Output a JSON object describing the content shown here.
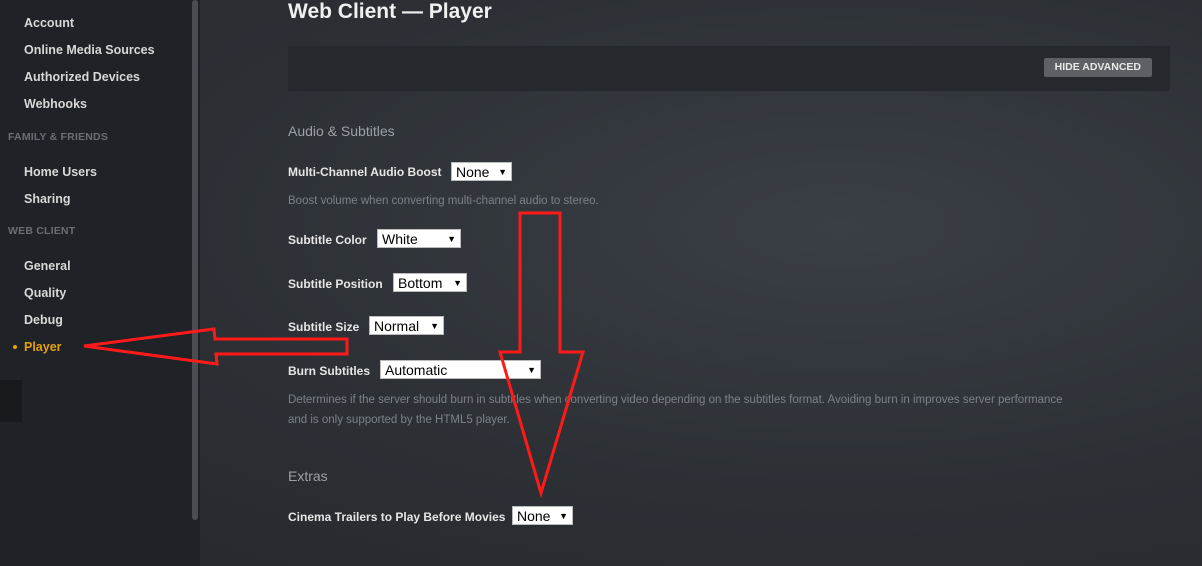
{
  "sidebar": {
    "items_top": [
      {
        "label": "Account"
      },
      {
        "label": "Online Media Sources"
      },
      {
        "label": "Authorized Devices"
      },
      {
        "label": "Webhooks"
      }
    ],
    "section_family": "FAMILY & FRIENDS",
    "items_family": [
      {
        "label": "Home Users"
      },
      {
        "label": "Sharing"
      }
    ],
    "section_web": "WEB CLIENT",
    "items_web": [
      {
        "label": "General"
      },
      {
        "label": "Quality"
      },
      {
        "label": "Debug"
      },
      {
        "label": "Player",
        "active": true
      }
    ],
    "accent_color": "#e5a00d"
  },
  "main": {
    "title": "Web Client — Player",
    "hide_advanced_label": "HIDE ADVANCED",
    "audio_section_title": "Audio & Subtitles",
    "multi_channel": {
      "label": "Multi-Channel Audio Boost",
      "value": "None",
      "help": "Boost volume when converting multi-channel audio to stereo."
    },
    "subtitle_color": {
      "label": "Subtitle Color",
      "value": "White"
    },
    "subtitle_position": {
      "label": "Subtitle Position",
      "value": "Bottom"
    },
    "subtitle_size": {
      "label": "Subtitle Size",
      "value": "Normal"
    },
    "burn_subtitles": {
      "label": "Burn Subtitles",
      "value": "Automatic",
      "help_line1": "Determines if the server should burn in subtitles when converting video depending on the subtitles format. Avoiding burn in improves server performance",
      "help_line2": "and is only supported by the HTML5 player."
    },
    "extras_section_title": "Extras",
    "cinema_trailers": {
      "label": "Cinema Trailers to Play Before Movies",
      "value": "None"
    }
  },
  "annotation_color": "#ff1a1a"
}
